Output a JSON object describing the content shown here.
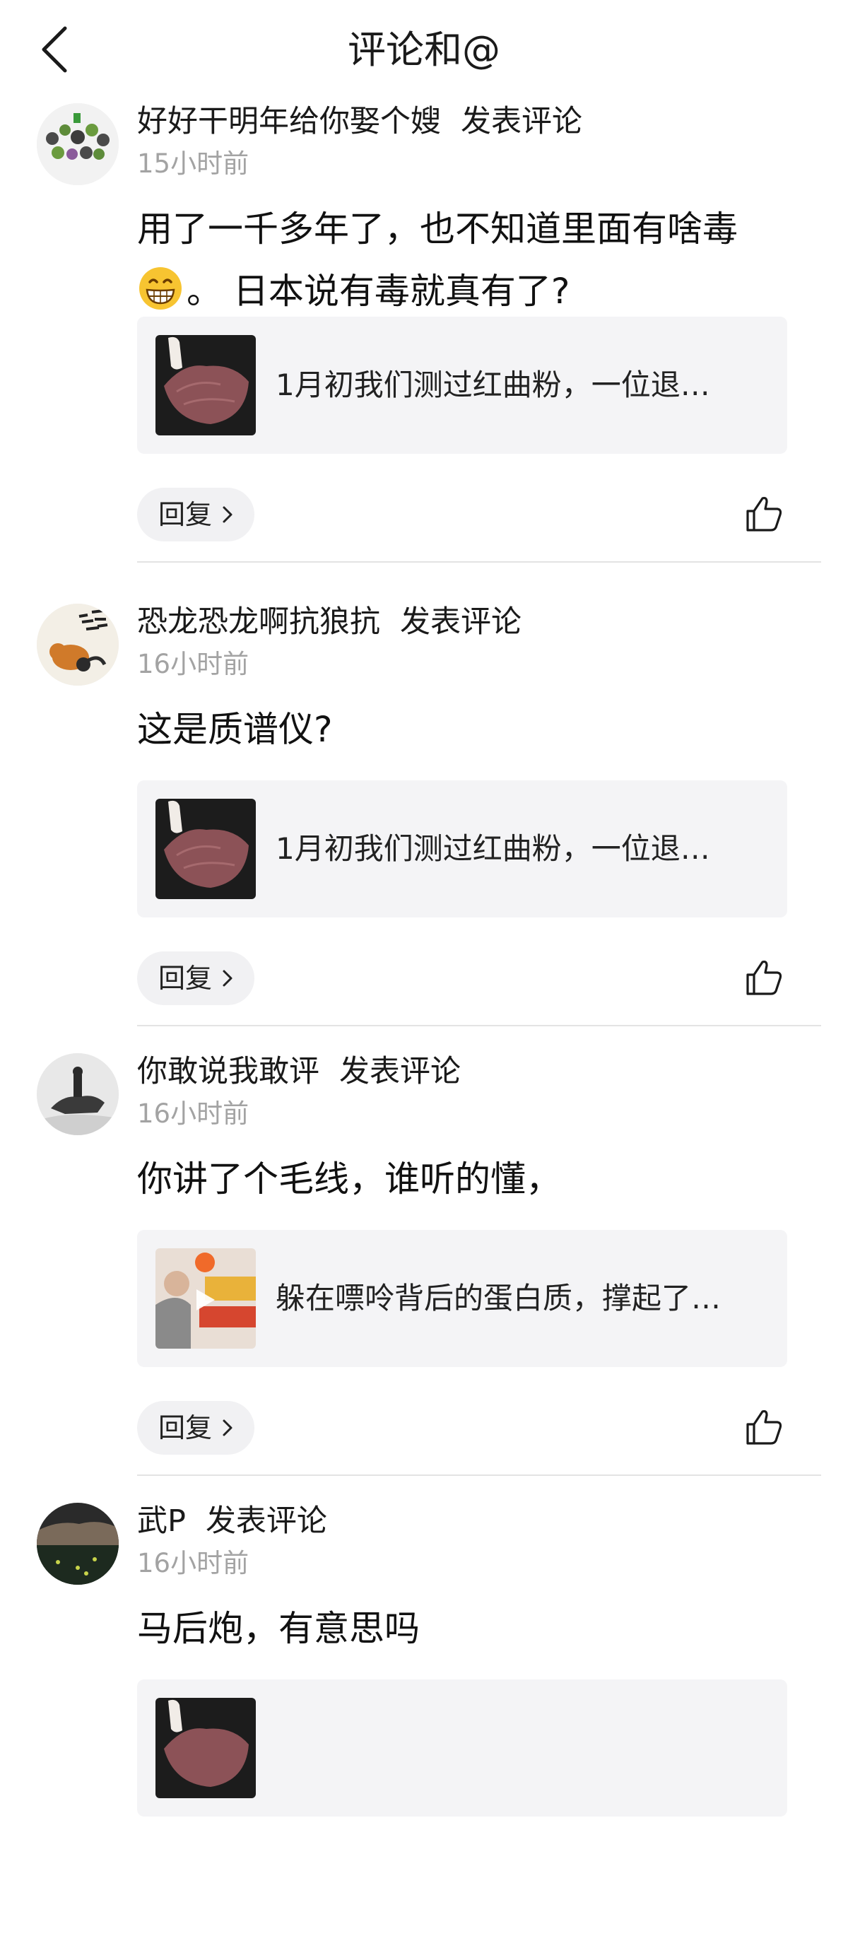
{
  "header": {
    "title": "评论和@",
    "back_icon": "chevron-left-icon"
  },
  "comments": [
    {
      "user": "好好干明年给你娶个嫂",
      "action": "发表评论",
      "time": "15小时前",
      "text_before_emoji": "用了一千多年了，也不知道里面有啥毒",
      "emoji": "grinning-face-icon",
      "text_after_emoji": "。 日本说有毒就真有了?",
      "ref_text": "1月初我们测过红曲粉，一位退…",
      "ref_thumb": "red-yeast-rice-bag-thumbnail",
      "reply_label": "回复",
      "like_icon": "thumbs-up-icon"
    },
    {
      "user": "恐龙恐龙啊抗狼抗",
      "action": "发表评论",
      "time": "16小时前",
      "text": "这是质谱仪?",
      "ref_text": "1月初我们测过红曲粉，一位退…",
      "ref_thumb": "red-yeast-rice-bag-thumbnail",
      "reply_label": "回复",
      "like_icon": "thumbs-up-icon"
    },
    {
      "user": "你敢说我敢评",
      "action": "发表评论",
      "time": "16小时前",
      "text": "你讲了个毛线，谁听的懂，",
      "ref_text": "躲在嘌呤背后的蛋白质，撑起了…",
      "ref_thumb": "video-thumbnail",
      "reply_label": "回复",
      "like_icon": "thumbs-up-icon"
    },
    {
      "user": "武P",
      "action": "发表评论",
      "time": "16小时前",
      "text": "马后炮，有意思吗",
      "ref_thumb": "red-yeast-rice-bag-thumbnail"
    }
  ],
  "colors": {
    "text": "#1a1a1a",
    "secondary_text": "#a3a3a3",
    "card_background": "#f4f4f6",
    "divider": "#e3e3e3"
  }
}
